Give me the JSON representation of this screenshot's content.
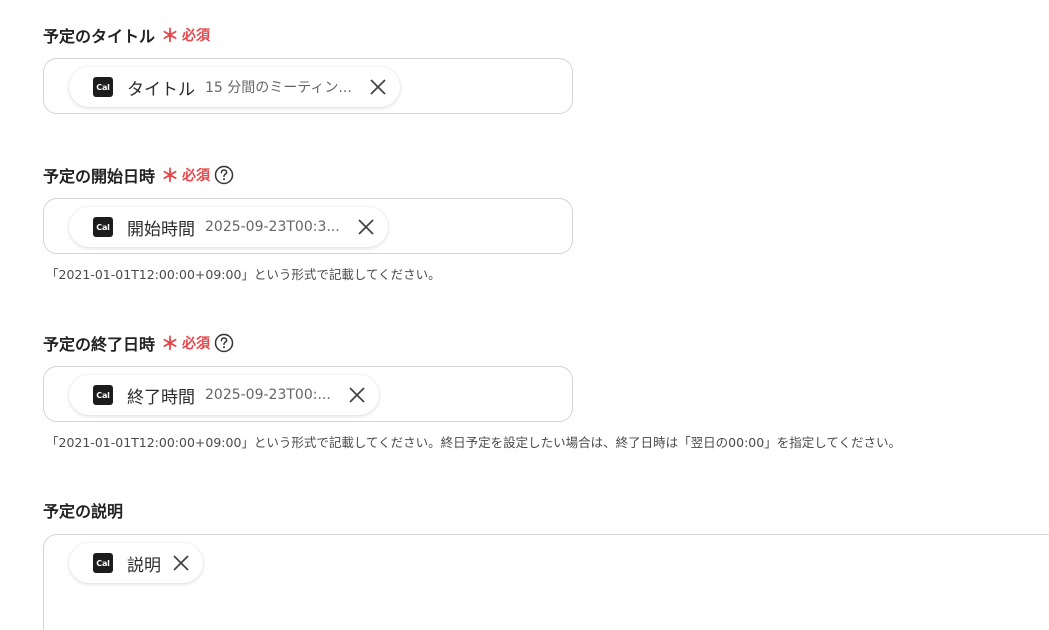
{
  "required_mark": "＊",
  "required_text": "必須",
  "fields": [
    {
      "label": "予定のタイトル",
      "required": true,
      "help": false,
      "chip": {
        "logo": "Cal",
        "name": "タイトル",
        "value": "15 分間のミーティン..."
      }
    },
    {
      "label": "予定の開始日時",
      "required": true,
      "help": true,
      "chip": {
        "logo": "Cal",
        "name": "開始時間",
        "value": "2025-09-23T00:3..."
      },
      "hint": "「2021-01-01T12:00:00+09:00」という形式で記載してください。"
    },
    {
      "label": "予定の終了日時",
      "required": true,
      "help": true,
      "chip": {
        "logo": "Cal",
        "name": "終了時間",
        "value": "2025-09-23T00:..."
      },
      "hint": "「2021-01-01T12:00:00+09:00」という形式で記載してください。終日予定を設定したい場合は、終了日時は「翌日の00:00」を指定してください。"
    },
    {
      "label": "予定の説明",
      "required": false,
      "help": false,
      "chip": {
        "logo": "Cal",
        "name": "説明",
        "value": ""
      }
    }
  ],
  "colors": {
    "required": "#e5484d",
    "border": "#d3d3d3",
    "logo_bg": "#1c1c1c"
  }
}
